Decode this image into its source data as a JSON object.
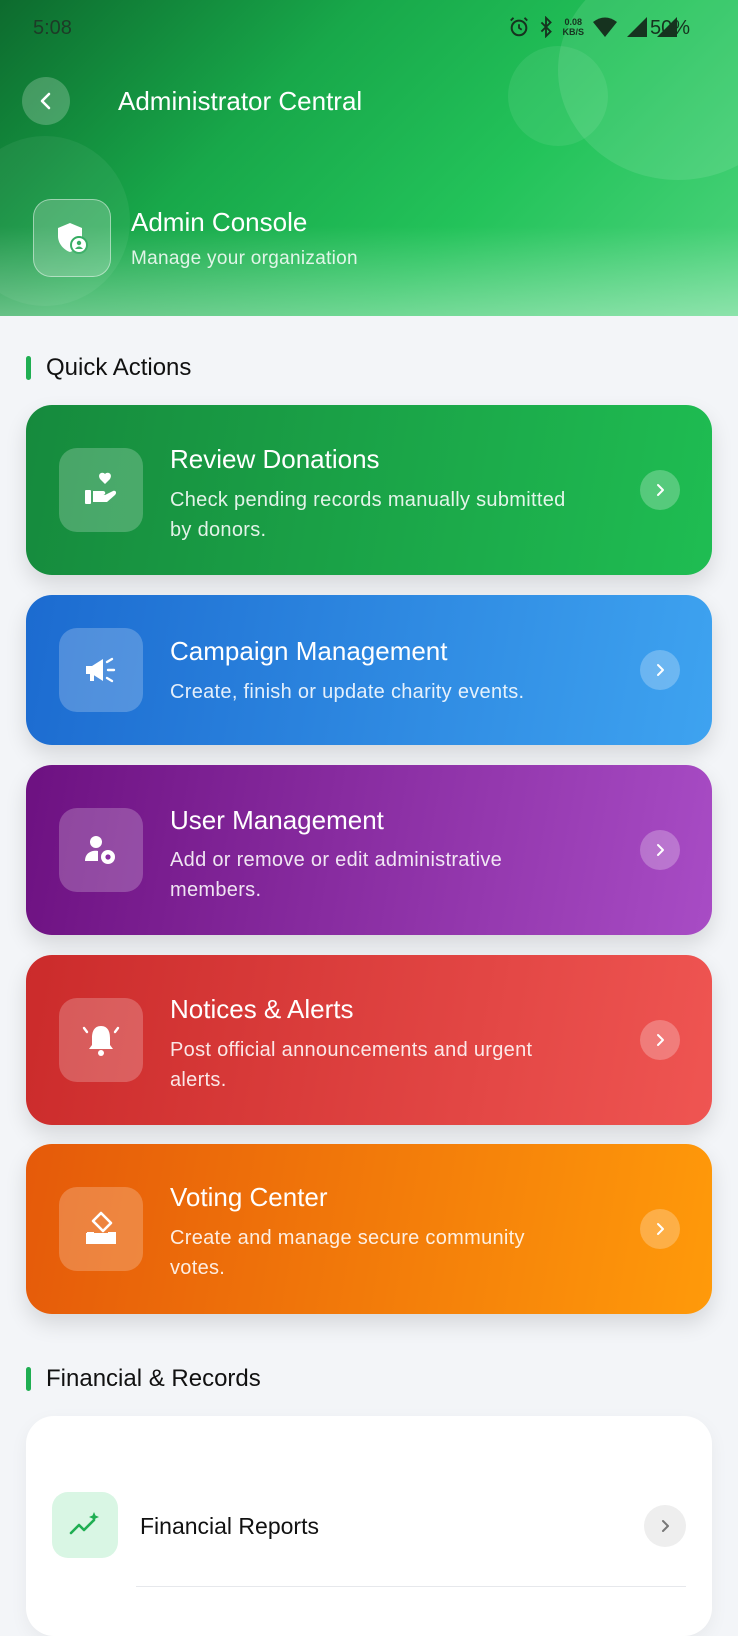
{
  "status_bar": {
    "time": "5:08",
    "net_speed_value": "0.08",
    "net_speed_unit": "KB/S",
    "battery": "50%"
  },
  "header": {
    "title": "Administrator Central",
    "console_title": "Admin Console",
    "console_subtitle": "Manage your organization"
  },
  "quick_actions": {
    "section_title": "Quick Actions",
    "items": [
      {
        "title": "Review Donations",
        "line1": "Check pending records manually submitted",
        "line2": "by donors.",
        "icon": "donation-hand-heart-icon",
        "color_from": "#168a3d",
        "color_to": "#1fbd52"
      },
      {
        "title": "Campaign Management",
        "line1": "Create, finish or update charity events.",
        "line2": "",
        "icon": "megaphone-icon",
        "color_from": "#1c6bd0",
        "color_to": "#3ea3f0"
      },
      {
        "title": "User Management",
        "line1": "Add or remove or edit administrative",
        "line2": "members.",
        "icon": "user-gear-icon",
        "color_from": "#6d1181",
        "color_to": "#a84cc5"
      },
      {
        "title": "Notices & Alerts",
        "line1": "Post official announcements and urgent",
        "line2": "alerts.",
        "icon": "bell-alert-icon",
        "color_from": "#cb2b2b",
        "color_to": "#ef5552"
      },
      {
        "title": "Voting Center",
        "line1": "Create and manage secure community",
        "line2": "votes.",
        "icon": "ballot-box-icon",
        "color_from": "#e55a0a",
        "color_to": "#ff9a0a"
      }
    ]
  },
  "records": {
    "section_title": "Financial & Records",
    "items": [
      {
        "label": "Financial Reports",
        "icon": "trending-chart-icon"
      }
    ]
  },
  "colors": {
    "accent_green": "#1fae52",
    "background": "#f3f5f8"
  }
}
